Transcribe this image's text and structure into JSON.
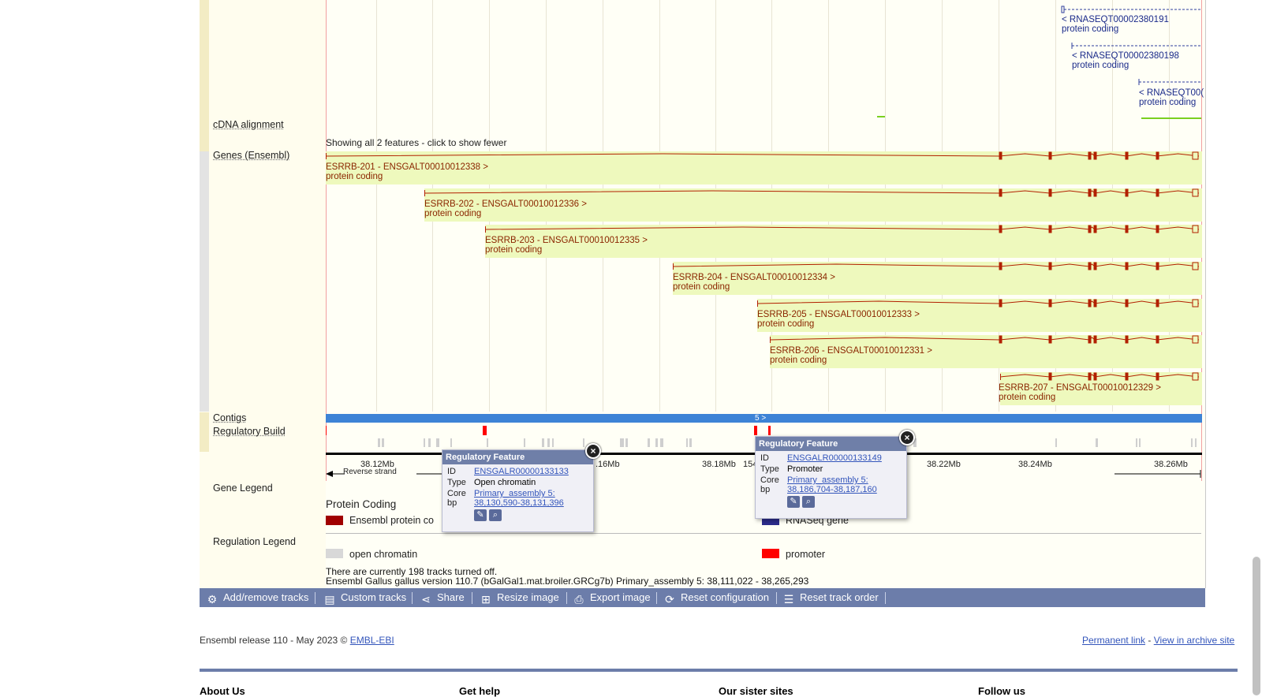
{
  "tracks": {
    "cdna_alignment": "cDNA alignment",
    "genes": "Genes (Ensembl)",
    "contigs": "Contigs",
    "regulatory_build": "Regulatory Build",
    "gene_legend": "Gene Legend",
    "regulation_legend": "Regulation Legend"
  },
  "rnaseq": [
    {
      "name": "< RNASEQT00002380191",
      "biotype": "protein coding"
    },
    {
      "name": "< RNASEQT00002380198",
      "biotype": "protein coding"
    },
    {
      "name": "< RNASEQT00(",
      "biotype": "protein coding"
    }
  ],
  "showing_features": "Showing all 2 features - click to show fewer",
  "transcripts": [
    {
      "name": "ESRRB-201 - ENSGALT00010012338 >",
      "biotype": "protein coding"
    },
    {
      "name": "ESRRB-202 - ENSGALT00010012336 >",
      "biotype": "protein coding"
    },
    {
      "name": "ESRRB-203 - ENSGALT00010012335 >",
      "biotype": "protein coding"
    },
    {
      "name": "ESRRB-204 - ENSGALT00010012334 >",
      "biotype": "protein coding"
    },
    {
      "name": "ESRRB-205 - ENSGALT00010012333 >",
      "biotype": "protein coding"
    },
    {
      "name": "ESRRB-206 - ENSGALT00010012331 >",
      "biotype": "protein coding"
    },
    {
      "name": "ESRRB-207 - ENSGALT00010012329 >",
      "biotype": "protein coding"
    }
  ],
  "contig_label": "5 >",
  "ruler": {
    "ticks": [
      "38.12Mb",
      ".16Mb",
      "38.18Mb",
      "154",
      "38.22Mb",
      "38.24Mb",
      "38.26Mb"
    ],
    "strand": "Reverse strand"
  },
  "popups": [
    {
      "title": "Regulatory Feature",
      "id_label": "ID",
      "id": "ENSGALR00000133133",
      "type_label": "Type",
      "type": "Open chromatin",
      "core_label": "Core bp",
      "core_line1": "Primary_assembly 5:",
      "core_line2": "38,130,590-38,131,396"
    },
    {
      "title": "Regulatory Feature",
      "id_label": "ID",
      "id": "ENSGALR00000133149",
      "type_label": "Type",
      "type": "Promoter",
      "core_label": "Core bp",
      "core_line1": "Primary_assembly 5:",
      "core_line2": "38,186,704-38,187,160"
    }
  ],
  "legend": {
    "protein_coding_heading": "Protein Coding",
    "ensembl_protein": "Ensembl protein co",
    "rnaseq_gene": "RNASeq gene",
    "open_chromatin": "open chromatin",
    "promoter": "promoter",
    "colors": {
      "ensembl_protein": "#a00000",
      "rnaseq_gene": "#2c2c8c",
      "open_chromatin": "#d8d8d8",
      "promoter": "#ff0000"
    }
  },
  "status": {
    "tracks_off": "There are currently 198 tracks turned off.",
    "assembly_info": "Ensembl Gallus gallus version 110.7 (bGalGal1.mat.broiler.GRCg7b) Primary_assembly 5: 38,111,022 - 38,265,293"
  },
  "toolbar": {
    "add_remove": "Add/remove tracks",
    "custom": "Custom tracks",
    "share": "Share",
    "resize": "Resize image",
    "export": "Export image",
    "reset_config": "Reset configuration",
    "reset_order": "Reset track order"
  },
  "footer": {
    "release": "Ensembl release 110 - May 2023 ©",
    "embl": "EMBL-EBI",
    "permanent": "Permanent link",
    "dash": "-",
    "archive": "View in archive site",
    "headings": [
      "About Us",
      "Get help",
      "Our sister sites",
      "Follow us"
    ]
  },
  "colors": {
    "transcript_fill": "#eef9bd",
    "transcript_line": "#b22000",
    "toolbar": "#6c7daa",
    "contig": "#3d83d6"
  }
}
